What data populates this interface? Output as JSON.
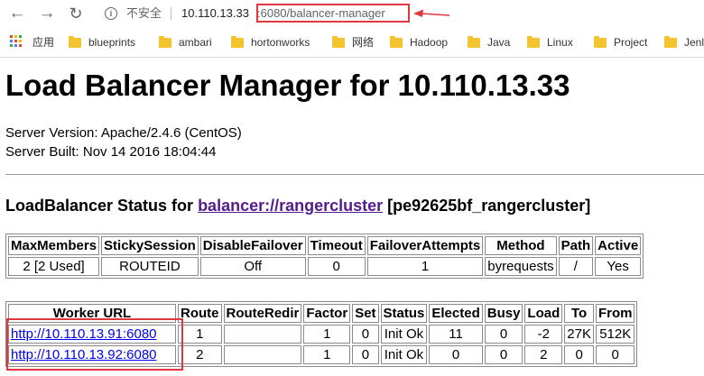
{
  "browser": {
    "security_text": "不安全",
    "url_host": "10.110.13.33",
    "url_path": ":6080/balancer-manager",
    "bookmarks": [
      "应用",
      "blueprints",
      "ambari",
      "hortonworks",
      "网络",
      "Hadoop",
      "Java",
      "Linux",
      "Project",
      "Jenl"
    ]
  },
  "page": {
    "title": "Load Balancer Manager for 10.110.13.33",
    "server_version": "Server Version: Apache/2.4.6 (CentOS)",
    "server_built": "Server Built: Nov 14 2016 18:04:44",
    "status_prefix": "LoadBalancer Status for",
    "balancer_link": "balancer://rangercluster",
    "balancer_id": "[pe92625bf_rangercluster]"
  },
  "balancer_table": {
    "headers": [
      "MaxMembers",
      "StickySession",
      "DisableFailover",
      "Timeout",
      "FailoverAttempts",
      "Method",
      "Path",
      "Active"
    ],
    "row": [
      "2 [2 Used]",
      "ROUTEID",
      "Off",
      "0",
      "1",
      "byrequests",
      "/",
      "Yes"
    ]
  },
  "workers_table": {
    "headers": [
      "Worker URL",
      "Route",
      "RouteRedir",
      "Factor",
      "Set",
      "Status",
      "Elected",
      "Busy",
      "Load",
      "To",
      "From"
    ],
    "rows": [
      [
        "http://10.110.13.91:6080",
        "1",
        "",
        "1",
        "0",
        "Init Ok",
        "11",
        "0",
        "-2",
        "27K",
        "512K"
      ],
      [
        "http://10.110.13.92:6080",
        "2",
        "",
        "1",
        "0",
        "Init Ok",
        "0",
        "0",
        "2",
        "0",
        "0"
      ]
    ]
  },
  "colors": {
    "annotation": "#e0383e",
    "visited_link": "#551a8b",
    "link": "#0000ee"
  },
  "icons": [
    "back-arrow-icon",
    "forward-arrow-icon",
    "reload-icon",
    "info-icon",
    "apps-grid-icon",
    "folder-icon"
  ]
}
